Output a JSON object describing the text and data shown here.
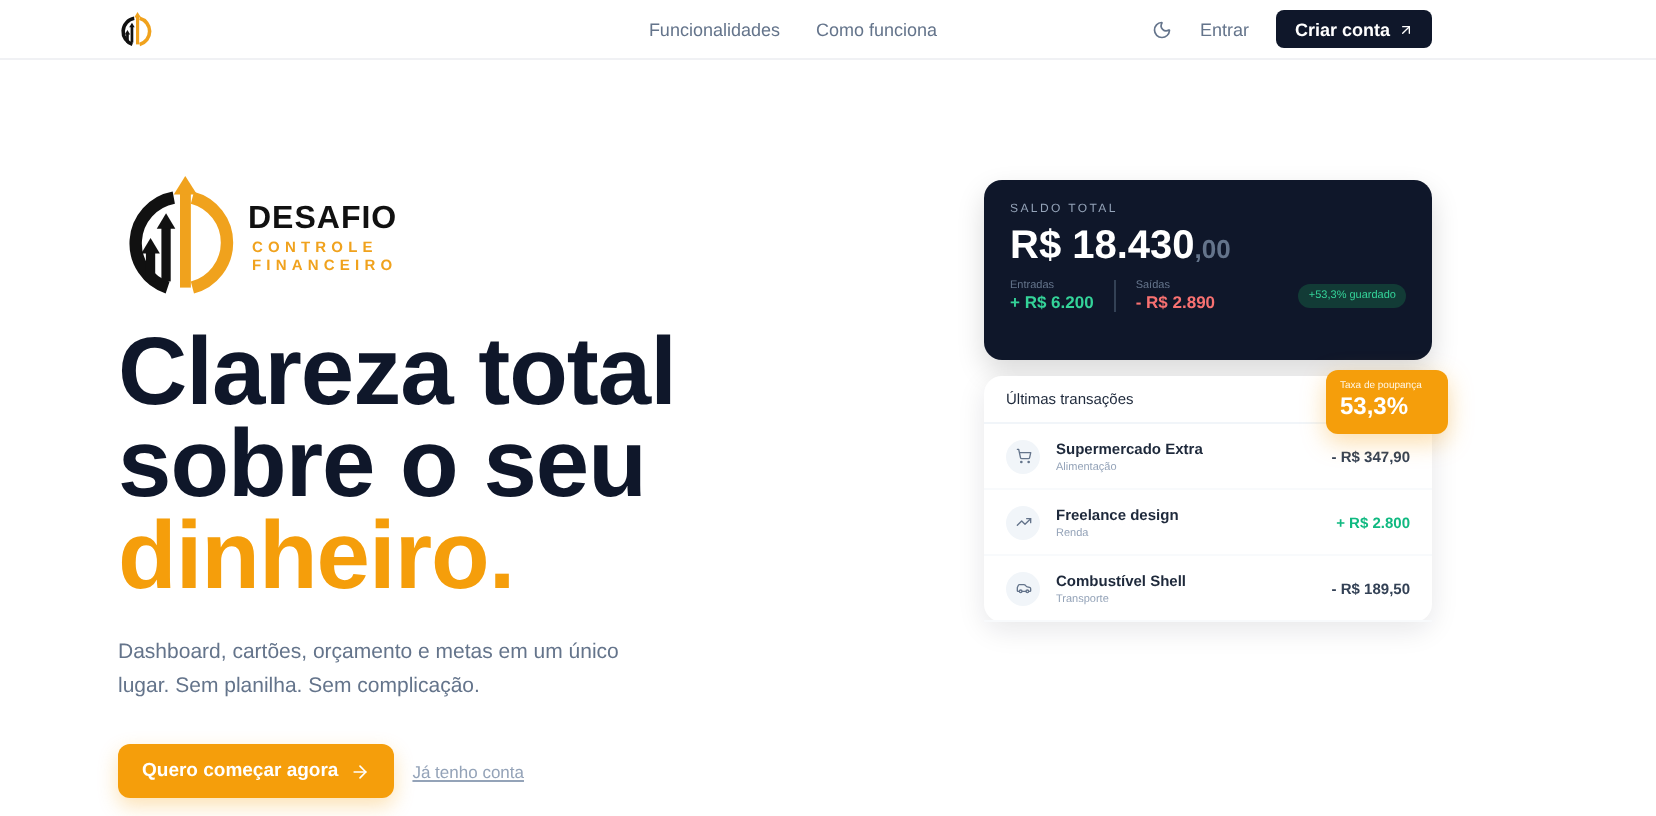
{
  "nav": {
    "links": [
      "Funcionalidades",
      "Como funciona"
    ],
    "login": "Entrar",
    "cta": "Criar conta"
  },
  "brand": {
    "title": "DESAFIO",
    "subtitle_1": "CONTROLE",
    "subtitle_2": "FINANCEIRO"
  },
  "hero": {
    "headline_1": "Clareza total",
    "headline_2": "sobre o seu",
    "headline_accent": "dinheiro.",
    "description": "Dashboard, cartões, orçamento e metas em um único lugar. Sem planilha. Sem complicação.",
    "primary_button": "Quero começar agora",
    "secondary_link": "Já tenho conta"
  },
  "balance": {
    "label": "SALDO TOTAL",
    "amount": "R$ 18.430",
    "cents": ",00",
    "income_label": "Entradas",
    "income": "+ R$ 6.200",
    "expense_label": "Saídas",
    "expense": "- R$ 2.890",
    "badge": "+53,3% guardado"
  },
  "savings": {
    "label": "Taxa de poupança",
    "value": "53,3%"
  },
  "transactions": {
    "title": "Últimas transações",
    "items": [
      {
        "name": "Supermercado Extra",
        "category": "Alimentação",
        "amount": "- R$ 347,90",
        "kind": "expense"
      },
      {
        "name": "Freelance design",
        "category": "Renda",
        "amount": "+ R$ 2.800",
        "kind": "income"
      },
      {
        "name": "Combustível Shell",
        "category": "Transporte",
        "amount": "- R$ 189,50",
        "kind": "expense"
      }
    ]
  }
}
